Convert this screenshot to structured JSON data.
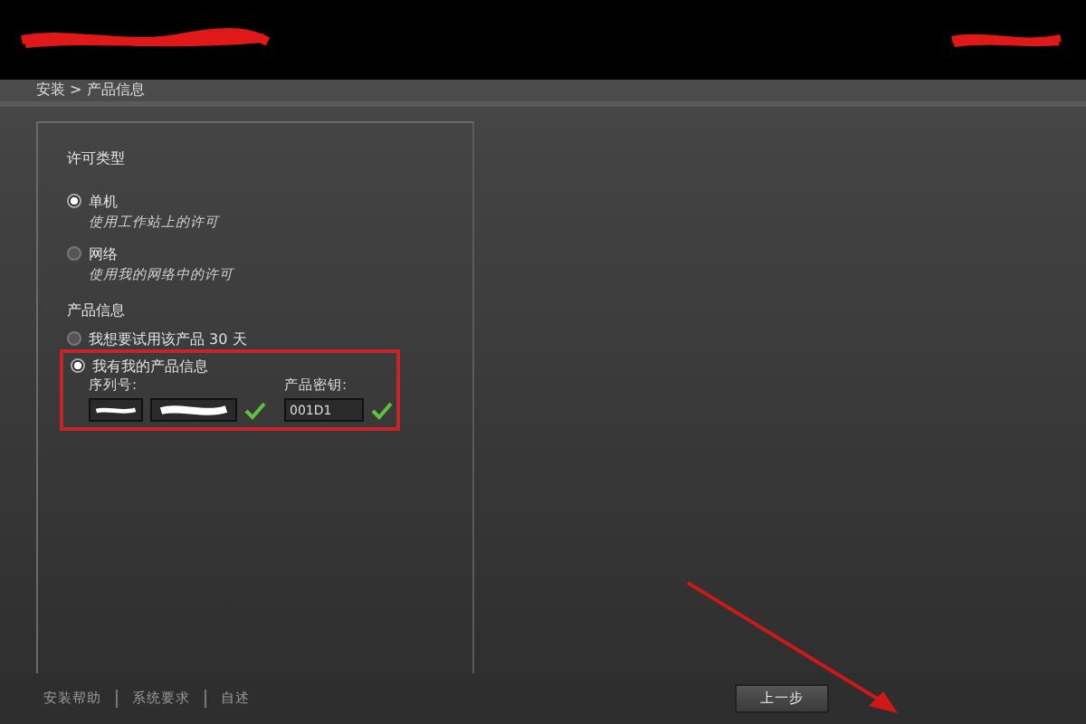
{
  "header": {
    "title_redacted": true,
    "logo_redacted": true
  },
  "breadcrumb": "安装 > 产品信息",
  "license_type": {
    "heading": "许可类型",
    "options": [
      {
        "label": "单机",
        "description": "使用工作站上的许可",
        "selected": true
      },
      {
        "label": "网络",
        "description": "使用我的网络中的许可",
        "selected": false
      }
    ]
  },
  "product_info": {
    "heading": "产品信息",
    "options": [
      {
        "label": "我想要试用该产品 30 天",
        "selected": false
      },
      {
        "label": "我有我的产品信息",
        "selected": true
      }
    ],
    "serial_number": {
      "label": "序列号:",
      "parts": [
        {
          "redacted": true
        },
        {
          "redacted": true
        }
      ],
      "valid": true
    },
    "product_key": {
      "label": "产品密钥:",
      "value": "001D1",
      "valid": true
    },
    "highlighted": true
  },
  "footer_links": [
    "安装帮助",
    "系统要求",
    "自述"
  ],
  "buttons": [
    "上一步"
  ],
  "annotation_arrow": true
}
